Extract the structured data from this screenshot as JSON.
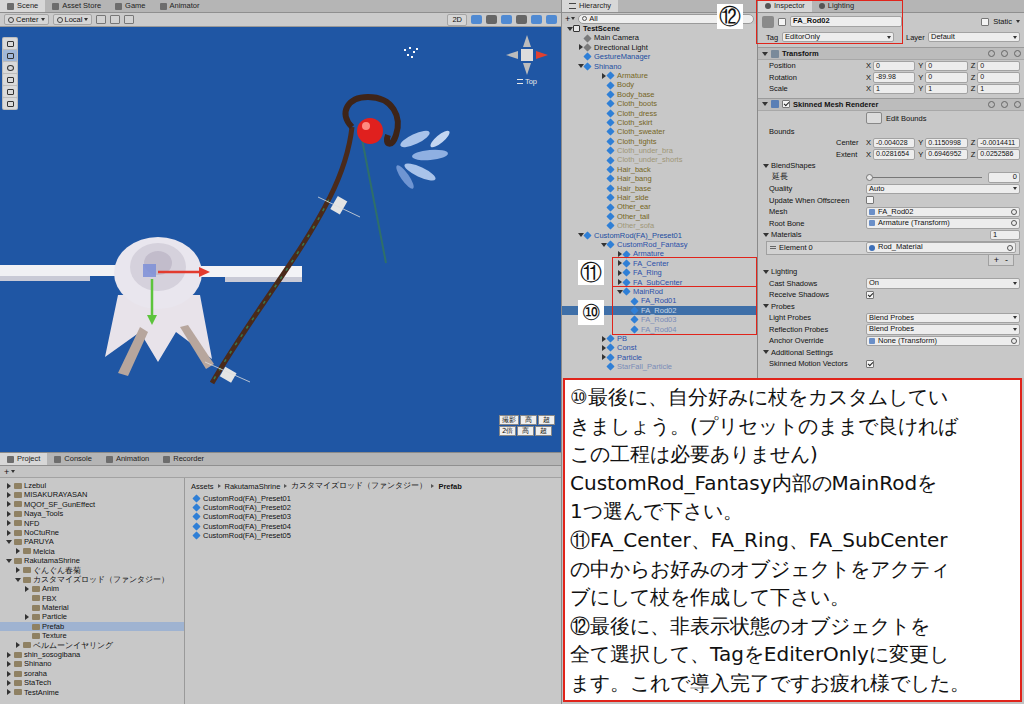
{
  "scene": {
    "tabs": [
      {
        "label": "Scene",
        "selected": true
      },
      {
        "label": "Asset Store",
        "selected": false
      },
      {
        "label": "Game",
        "selected": false
      },
      {
        "label": "Animator",
        "selected": false
      }
    ],
    "pivot": "Center",
    "space": "Local",
    "mode_2d": "2D",
    "gizmo_label": "Top",
    "overlay_buttons": [
      [
        "撮影",
        "高",
        "超"
      ],
      [
        "2倍",
        "高",
        "超"
      ]
    ]
  },
  "hierarchy": {
    "title": "Hierarchy",
    "add": "+",
    "search": "All",
    "items": [
      {
        "label": "TestScene",
        "depth": 0,
        "expandable": true,
        "expanded": true,
        "selected": false,
        "active": true,
        "kind": "scene",
        "color": "#111111"
      },
      {
        "label": "Main Camera",
        "depth": 1,
        "expandable": false,
        "expanded": false,
        "selected": false,
        "active": true,
        "kind": "object",
        "color": "#111111"
      },
      {
        "label": "Directional Light",
        "depth": 1,
        "expandable": true,
        "expanded": false,
        "selected": false,
        "active": true,
        "kind": "object",
        "color": "#111111"
      },
      {
        "label": "GestureManager",
        "depth": 1,
        "expandable": false,
        "expanded": false,
        "selected": false,
        "active": true,
        "kind": "prefab",
        "color": "#1c4da1"
      },
      {
        "label": "Shinano",
        "depth": 1,
        "expandable": true,
        "expanded": true,
        "selected": false,
        "active": true,
        "kind": "prefab",
        "color": "#1c4da1"
      },
      {
        "label": "Armature",
        "depth": 2,
        "expandable": true,
        "expanded": false,
        "selected": false,
        "active": true,
        "kind": "prefab",
        "color": "#76661f"
      },
      {
        "label": "Body",
        "depth": 2,
        "expandable": false,
        "expanded": false,
        "selected": false,
        "active": true,
        "kind": "prefab",
        "color": "#76661f"
      },
      {
        "label": "Body_base",
        "depth": 2,
        "expandable": false,
        "expanded": false,
        "selected": false,
        "active": true,
        "kind": "prefab",
        "color": "#76661f"
      },
      {
        "label": "Cloth_boots",
        "depth": 2,
        "expandable": false,
        "expanded": false,
        "selected": false,
        "active": true,
        "kind": "prefab",
        "color": "#76661f"
      },
      {
        "label": "Cloth_dress",
        "depth": 2,
        "expandable": false,
        "expanded": false,
        "selected": false,
        "active": true,
        "kind": "prefab",
        "color": "#76661f"
      },
      {
        "label": "Cloth_skirt",
        "depth": 2,
        "expandable": false,
        "expanded": false,
        "selected": false,
        "active": true,
        "kind": "prefab",
        "color": "#76661f"
      },
      {
        "label": "Cloth_sweater",
        "depth": 2,
        "expandable": false,
        "expanded": false,
        "selected": false,
        "active": true,
        "kind": "prefab",
        "color": "#76661f"
      },
      {
        "label": "Cloth_tights",
        "depth": 2,
        "expandable": false,
        "expanded": false,
        "selected": false,
        "active": true,
        "kind": "prefab",
        "color": "#76661f"
      },
      {
        "label": "Cloth_under_bra",
        "depth": 2,
        "expandable": false,
        "expanded": false,
        "selected": false,
        "active": false,
        "kind": "prefab",
        "color": "#76661f"
      },
      {
        "label": "Cloth_under_shorts",
        "depth": 2,
        "expandable": false,
        "expanded": false,
        "selected": false,
        "active": false,
        "kind": "prefab",
        "color": "#76661f"
      },
      {
        "label": "Hair_back",
        "depth": 2,
        "expandable": false,
        "expanded": false,
        "selected": false,
        "active": true,
        "kind": "prefab",
        "color": "#76661f"
      },
      {
        "label": "Hair_bang",
        "depth": 2,
        "expandable": false,
        "expanded": false,
        "selected": false,
        "active": true,
        "kind": "prefab",
        "color": "#76661f"
      },
      {
        "label": "Hair_base",
        "depth": 2,
        "expandable": false,
        "expanded": false,
        "selected": false,
        "active": true,
        "kind": "prefab",
        "color": "#76661f"
      },
      {
        "label": "Hair_side",
        "depth": 2,
        "expandable": false,
        "expanded": false,
        "selected": false,
        "active": true,
        "kind": "prefab",
        "color": "#76661f"
      },
      {
        "label": "Other_ear",
        "depth": 2,
        "expandable": false,
        "expanded": false,
        "selected": false,
        "active": true,
        "kind": "prefab",
        "color": "#76661f"
      },
      {
        "label": "Other_tail",
        "depth": 2,
        "expandable": false,
        "expanded": false,
        "selected": false,
        "active": true,
        "kind": "prefab",
        "color": "#76661f"
      },
      {
        "label": "Other_sofa",
        "depth": 2,
        "expandable": false,
        "expanded": false,
        "selected": false,
        "active": false,
        "kind": "prefab",
        "color": "#76661f"
      },
      {
        "label": "CustomRod(FA)_Preset01",
        "depth": 1,
        "expandable": true,
        "expanded": true,
        "selected": false,
        "active": true,
        "kind": "prefab",
        "color": "#1c4da1"
      },
      {
        "label": "CustomRod_Fantasy",
        "depth": 2,
        "expandable": true,
        "expanded": true,
        "selected": false,
        "active": true,
        "kind": "prefab",
        "color": "#2a4fa8"
      },
      {
        "label": "Armature",
        "depth": 3,
        "expandable": true,
        "expanded": false,
        "selected": false,
        "active": true,
        "kind": "prefab",
        "color": "#2a4fa8"
      },
      {
        "label": "FA_Center",
        "depth": 3,
        "expandable": true,
        "expanded": false,
        "selected": false,
        "active": true,
        "kind": "prefab",
        "color": "#2a4fa8"
      },
      {
        "label": "FA_Ring",
        "depth": 3,
        "expandable": true,
        "expanded": false,
        "selected": false,
        "active": true,
        "kind": "prefab",
        "color": "#2a4fa8"
      },
      {
        "label": "FA_SubCenter",
        "depth": 3,
        "expandable": true,
        "expanded": false,
        "selected": false,
        "active": true,
        "kind": "prefab",
        "color": "#2a4fa8"
      },
      {
        "label": "MainRod",
        "depth": 3,
        "expandable": true,
        "expanded": true,
        "selected": false,
        "active": true,
        "kind": "prefab",
        "color": "#2a4fa8"
      },
      {
        "label": "FA_Rod01",
        "depth": 4,
        "expandable": false,
        "expanded": false,
        "selected": false,
        "active": true,
        "kind": "prefab",
        "color": "#2a4fa8"
      },
      {
        "label": "FA_Rod02",
        "depth": 4,
        "expandable": false,
        "expanded": false,
        "selected": true,
        "active": false,
        "kind": "prefab",
        "color": "#e4ecf7"
      },
      {
        "label": "FA_Rod03",
        "depth": 4,
        "expandable": false,
        "expanded": false,
        "selected": false,
        "active": false,
        "kind": "prefab",
        "color": "#2a4fa8"
      },
      {
        "label": "FA_Rod04",
        "depth": 4,
        "expandable": false,
        "expanded": false,
        "selected": false,
        "active": false,
        "kind": "prefab",
        "color": "#2a4fa8"
      },
      {
        "label": "PB",
        "depth": 2,
        "expandable": true,
        "expanded": false,
        "selected": false,
        "active": true,
        "kind": "prefab",
        "color": "#2a4fa8"
      },
      {
        "label": "Const",
        "depth": 2,
        "expandable": true,
        "expanded": false,
        "selected": false,
        "active": true,
        "kind": "prefab",
        "color": "#2a4fa8"
      },
      {
        "label": "Particle",
        "depth": 2,
        "expandable": true,
        "expanded": false,
        "selected": false,
        "active": true,
        "kind": "prefab",
        "color": "#2a4fa8"
      },
      {
        "label": "StarFall_Particle",
        "depth": 2,
        "expandable": false,
        "expanded": false,
        "selected": false,
        "active": false,
        "kind": "prefab",
        "color": "#2a4fa8"
      }
    ]
  },
  "inspector": {
    "tabs": [
      {
        "label": "Inspector",
        "selected": true
      },
      {
        "label": "Lighting",
        "selected": false
      }
    ],
    "object": {
      "active": false,
      "name": "FA_Rod02",
      "static_label": "Static",
      "static": false,
      "tag_label": "Tag",
      "tag": "EditorOnly",
      "layer_label": "Layer",
      "layer": "Default"
    },
    "axes": [
      "X",
      "Y",
      "Z"
    ],
    "transform": {
      "title": "Transform",
      "expanded": true,
      "rows": [
        {
          "label": "Position",
          "values": [
            "0",
            "0",
            "0"
          ]
        },
        {
          "label": "Rotation",
          "values": [
            "-89.98",
            "0",
            "0"
          ]
        },
        {
          "label": "Scale",
          "values": [
            "1",
            "1",
            "1"
          ]
        }
      ]
    },
    "renderer": {
      "title": "Skinned Mesh Renderer",
      "expanded": true,
      "enabled": true,
      "edit_bounds": "Edit Bounds",
      "bounds_label": "Bounds",
      "bounds": [
        {
          "label": "Center",
          "values": [
            "-0.004028",
            "0.1150998",
            "-0.0014411"
          ]
        },
        {
          "label": "Extent",
          "values": [
            "0.0281654",
            "0.6946952",
            "0.0252586"
          ]
        }
      ],
      "fields": [
        {
          "kind": "foldout",
          "label": "BlendShapes",
          "expanded": true
        },
        {
          "kind": "slider",
          "label": "延長",
          "level": 0,
          "value": "0"
        },
        {
          "kind": "dropdown",
          "label": "Quality",
          "value": "Auto"
        },
        {
          "kind": "checkbox",
          "label": "Update When Offscreen",
          "checked": false
        },
        {
          "kind": "object",
          "label": "Mesh",
          "value": "FA_Rod02"
        },
        {
          "kind": "object",
          "label": "Root Bone",
          "value": "Armature (Transform)"
        },
        {
          "kind": "foldout",
          "label": "Materials",
          "expanded": true,
          "value": "1"
        },
        {
          "kind": "list_item",
          "label": "Element 0",
          "value": "Rod_Material"
        },
        {
          "kind": "buttons",
          "items": [
            "+",
            "-"
          ]
        },
        {
          "kind": "foldout",
          "label": "Lighting",
          "expanded": true
        },
        {
          "kind": "dropdown",
          "label": "Cast Shadows",
          "value": "On"
        },
        {
          "kind": "checkbox",
          "label": "Receive Shadows",
          "checked": true
        },
        {
          "kind": "foldout",
          "label": "Probes",
          "expanded": true
        },
        {
          "kind": "dropdown",
          "label": "Light Probes",
          "value": "Blend Probes"
        },
        {
          "kind": "dropdown",
          "label": "Reflection Probes",
          "value": "Blend Probes"
        },
        {
          "kind": "object",
          "label": "Anchor Override",
          "value": "None (Transform)"
        },
        {
          "kind": "foldout",
          "label": "Additional Settings",
          "expanded": true
        },
        {
          "kind": "checkbox",
          "label": "Skinned Motion Vectors",
          "checked": true
        }
      ]
    }
  },
  "project": {
    "tabs": [
      {
        "label": "Project",
        "selected": true
      },
      {
        "label": "Console",
        "selected": false
      },
      {
        "label": "Animation",
        "selected": false
      },
      {
        "label": "Recorder",
        "selected": false
      }
    ],
    "add": "+",
    "folders": [
      {
        "label": "Lzebul",
        "depth": 0,
        "expandable": true,
        "expanded": false,
        "selected": false
      },
      {
        "label": "MISAKURAYASAN",
        "depth": 0,
        "expandable": true,
        "expanded": false,
        "selected": false
      },
      {
        "label": "MQOf_SF_GunEffect",
        "depth": 0,
        "expandable": true,
        "expanded": false,
        "selected": false
      },
      {
        "label": "Naya_Tools",
        "depth": 0,
        "expandable": true,
        "expanded": false,
        "selected": false
      },
      {
        "label": "NFD",
        "depth": 0,
        "expandable": true,
        "expanded": false,
        "selected": false
      },
      {
        "label": "NoCtuRne",
        "depth": 0,
        "expandable": true,
        "expanded": false,
        "selected": false
      },
      {
        "label": "PARUYA",
        "depth": 0,
        "expandable": true,
        "expanded": true,
        "selected": false
      },
      {
        "label": "Melcia",
        "depth": 1,
        "expandable": true,
        "expanded": false,
        "selected": false
      },
      {
        "label": "RakutamaShrine",
        "depth": 0,
        "expandable": true,
        "expanded": true,
        "selected": false
      },
      {
        "label": "ぐんぐん春菊",
        "depth": 1,
        "expandable": true,
        "expanded": false,
        "selected": false
      },
      {
        "label": "カスタマイズロッド（ファンタジー）",
        "depth": 1,
        "expandable": true,
        "expanded": true,
        "selected": false
      },
      {
        "label": "Anim",
        "depth": 2,
        "expandable": true,
        "expanded": false,
        "selected": false
      },
      {
        "label": "FBX",
        "depth": 2,
        "expandable": false,
        "expanded": false,
        "selected": false
      },
      {
        "label": "Material",
        "depth": 2,
        "expandable": false,
        "expanded": false,
        "selected": false
      },
      {
        "label": "Particle",
        "depth": 2,
        "expandable": true,
        "expanded": false,
        "selected": false
      },
      {
        "label": "Prefab",
        "depth": 2,
        "expandable": false,
        "expanded": false,
        "selected": true
      },
      {
        "label": "Texture",
        "depth": 2,
        "expandable": false,
        "expanded": false,
        "selected": false
      },
      {
        "label": "ベルムーンイヤリング",
        "depth": 1,
        "expandable": true,
        "expanded": false,
        "selected": false
      },
      {
        "label": "shin_sosogibana",
        "depth": 0,
        "expandable": true,
        "expanded": false,
        "selected": false
      },
      {
        "label": "Shinano",
        "depth": 0,
        "expandable": true,
        "expanded": false,
        "selected": false
      },
      {
        "label": "soraha",
        "depth": 0,
        "expandable": true,
        "expanded": false,
        "selected": false
      },
      {
        "label": "StaTech",
        "depth": 0,
        "expandable": true,
        "expanded": false,
        "selected": false
      },
      {
        "label": "TestAnime",
        "depth": 0,
        "expandable": true,
        "expanded": false,
        "selected": false
      }
    ],
    "breadcrumb": [
      "Assets",
      "RakutamaShrine",
      "カスタマイズロッド（ファンタジー）",
      "Prefab"
    ],
    "files": [
      "CustomRod(FA)_Preset01",
      "CustomRod(FA)_Preset02",
      "CustomRod(FA)_Preset03",
      "CustomRod(FA)_Preset04",
      "CustomRod(FA)_Preset05"
    ]
  },
  "note": {
    "lines": [
      "⑩最後に、自分好みに杖をカスタムしてい",
      "きましょう。(プリセットのままで良ければ",
      "この工程は必要ありません)",
      "CustomRod_Fantasy内部のMainRodを",
      "1つ選んで下さい。",
      "⑪FA_Center、FA_Ring、FA_SubCenter",
      "の中からお好みのオブジェクトをアクティ",
      "ブにして杖を作成して下さい。",
      "⑫最後に、非表示状態のオブジェクトを",
      "全て選択して、TagをEditerOnlyに変更し",
      "ます。これで導入完了ですお疲れ様でした。"
    ]
  },
  "callouts": [
    {
      "label": "⑩"
    },
    {
      "label": "⑪"
    },
    {
      "label": "⑫"
    }
  ]
}
